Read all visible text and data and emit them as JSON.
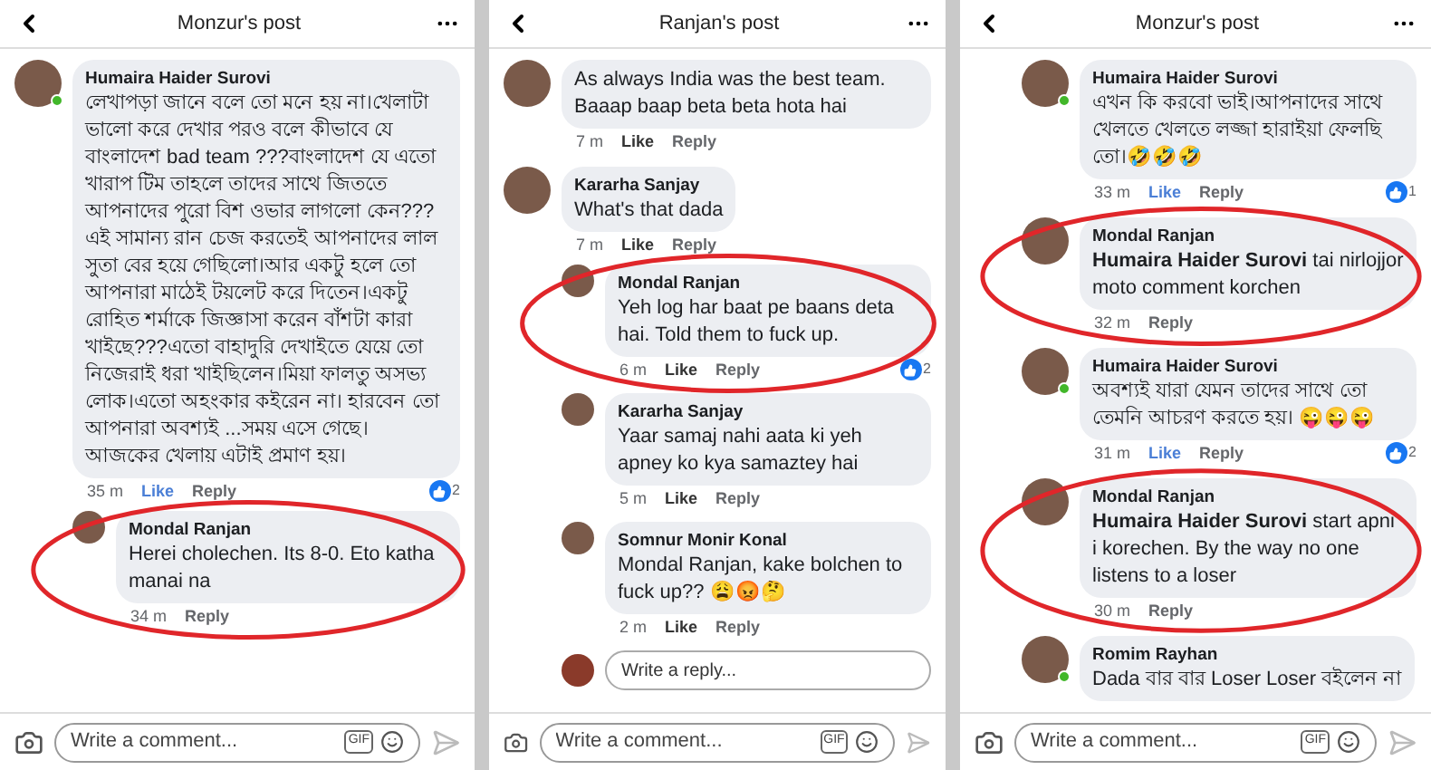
{
  "panels": [
    {
      "title": "Monzur's post",
      "indented": false,
      "composer": {
        "placeholder": "Write a comment...",
        "gif": "GIF"
      },
      "comments": [
        {
          "author": "Humaira Haider Surovi",
          "body": "লেখাপড়া জানে বলে তো মনে হয় না।খেলাটা ভালো করে দেখার পরও বলে কীভাবে যে বাংলাদেশ bad team ???বাংলাদেশ যে এতো খারাপ টিম তাহলে তাদের সাথে জিততে আপনাদের পুরো বিশ ওভার লাগলো কেন??? এই সামান্য রান চেজ করতেই আপনাদের লাল সুতা বের হয়ে গেছিলো।আর একটু হলে তো আপনারা মাঠেই টয়লেট করে দিতেন।একটু রোহিত শর্মাকে জিজ্ঞাসা করেন বাঁশটা কারা খাইছে???এতো বাহাদুরি দেখাইতে যেয়ে তো নিজেরাই ধরা খাইছিলেন।মিয়া ফালতু অসভ্য লোক।এতো অহংকার কইরেন না। হারবেন তো আপনারা অবশ্যই ...সময় এসে গেছে। আজকের খেলায় এটাই প্রমাণ হয়।",
          "time": "35 m",
          "like": "Like",
          "reply": "Reply",
          "liked": true,
          "reactions": "2",
          "online": true,
          "highlighted": false,
          "children": [
            {
              "author": "Mondal Ranjan",
              "body": "Herei cholechen. Its 8-0. Eto katha manai na",
              "time": "34 m",
              "reply": "Reply",
              "online": false,
              "highlighted": true
            }
          ]
        }
      ]
    },
    {
      "title": "Ranjan's post",
      "indented": false,
      "composer": {
        "placeholder": "Write a comment...",
        "gif": "GIF"
      },
      "comments": [
        {
          "body": "As always India was the best team. Baaap baap beta beta hota hai",
          "time": "7 m",
          "like": "Like",
          "reply": "Reply",
          "liked": false,
          "online": false,
          "highlighted": false
        },
        {
          "author": "Kararha Sanjay",
          "body": "What's that dada",
          "time": "7 m",
          "like": "Like",
          "reply": "Reply",
          "liked": false,
          "online": false,
          "highlighted": false,
          "reply_field": {
            "placeholder": "Write a reply..."
          },
          "children": [
            {
              "author": "Mondal Ranjan",
              "body": "Yeh log har baat pe baans deta hai. Told them to fuck up.",
              "time": "6 m",
              "like": "Like",
              "reply": "Reply",
              "liked": false,
              "reactions": "2",
              "online": false,
              "highlighted": true
            },
            {
              "author": "Kararha Sanjay",
              "body": "Yaar samaj nahi aata ki yeh apney ko kya samaztey hai",
              "time": "5 m",
              "like": "Like",
              "reply": "Reply",
              "liked": false,
              "online": false,
              "highlighted": false
            },
            {
              "author": "Somnur Monir Konal",
              "body": "Mondal Ranjan, kake bolchen to fuck up?? 😩😡🤔",
              "time": "2 m",
              "like": "Like",
              "reply": "Reply",
              "liked": false,
              "online": false,
              "highlighted": false
            }
          ]
        }
      ]
    },
    {
      "title": "Monzur's post",
      "indented": true,
      "composer": {
        "placeholder": "Write a comment...",
        "gif": "GIF"
      },
      "comments": [
        {
          "author": "Humaira Haider Surovi",
          "body": "এখন কি করবো ভাই।আপনাদের সাথে খেলতে খেলতে লজ্জা হারাইয়া ফেলছি তো।🤣🤣🤣",
          "time": "33 m",
          "like": "Like",
          "reply": "Reply",
          "liked": true,
          "reactions": "1",
          "online": true,
          "highlighted": false
        },
        {
          "author": "Mondal Ranjan",
          "body": "**Humaira Haider Surovi** tai nirlojjor moto comment korchen",
          "time": "32 m",
          "reply": "Reply",
          "online": false,
          "highlighted": true
        },
        {
          "author": "Humaira Haider Surovi",
          "body": "অবশ্যই যারা যেমন তাদের সাথে তো তেমনি আচরণ করতে হয়। 😜😜😜",
          "time": "31 m",
          "like": "Like",
          "reply": "Reply",
          "liked": true,
          "reactions": "2",
          "online": true,
          "highlighted": false
        },
        {
          "author": "Mondal Ranjan",
          "body": "**Humaira Haider Surovi** start apni i korechen. By the way no one listens to a loser",
          "time": "30 m",
          "reply": "Reply",
          "online": false,
          "highlighted": true
        },
        {
          "author": "Romim Rayhan",
          "body": "Dada বার বার Loser Loser বইলেন না",
          "online": true,
          "highlighted": false
        }
      ]
    }
  ]
}
